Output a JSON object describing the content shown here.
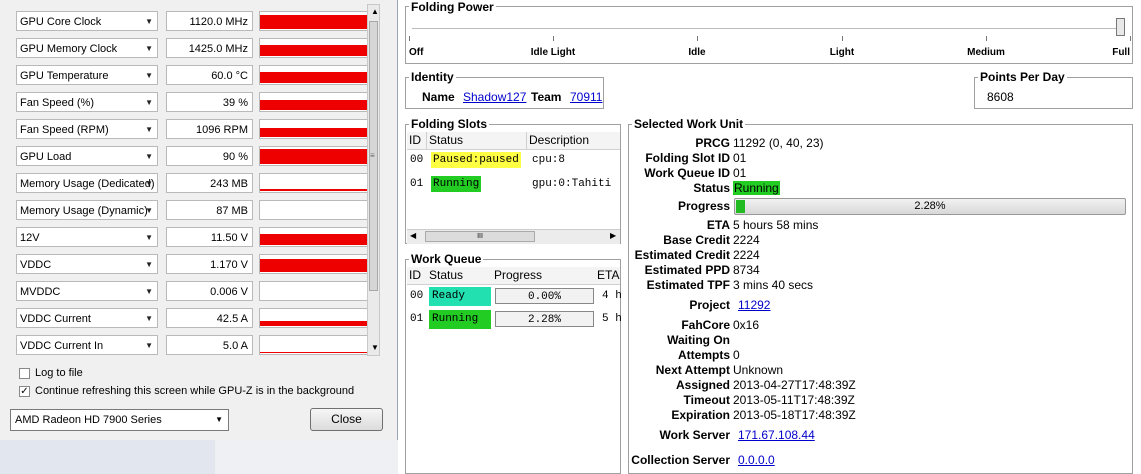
{
  "gpuz": {
    "sensors": [
      {
        "name": "GPU Core Clock",
        "value": "1120.0 MHz",
        "level": 0.78
      },
      {
        "name": "GPU Memory Clock",
        "value": "1425.0 MHz",
        "level": 0.62
      },
      {
        "name": "GPU Temperature",
        "value": "60.0 °C",
        "level": 0.6
      },
      {
        "name": "Fan Speed (%)",
        "value": "39 %",
        "level": 0.55
      },
      {
        "name": "Fan Speed (RPM)",
        "value": "1096 RPM",
        "level": 0.5
      },
      {
        "name": "GPU Load",
        "value": "90 %",
        "level": 0.85
      },
      {
        "name": "Memory Usage (Dedicated)",
        "value": "243 MB",
        "level": 0.1
      },
      {
        "name": "Memory Usage (Dynamic)",
        "value": "87 MB",
        "level": 0.0
      },
      {
        "name": "12V",
        "value": "11.50 V",
        "level": 0.6
      },
      {
        "name": "VDDC",
        "value": "1.170 V",
        "level": 0.7
      },
      {
        "name": "MVDDC",
        "value": "0.006 V",
        "level": 0.0
      },
      {
        "name": "VDDC Current",
        "value": "42.5 A",
        "level": 0.3
      },
      {
        "name": "VDDC Current In",
        "value": "5.0 A",
        "level": 0.05
      }
    ],
    "log_to_file": "Log to file",
    "continue_refresh": "Continue refreshing this screen while GPU-Z is in the background",
    "gpu_select": "AMD Radeon HD 7900 Series",
    "close_label": "Close",
    "colors": {
      "graph": "#ee0000"
    }
  },
  "fah": {
    "folding_power": {
      "title": "Folding Power",
      "ticks": [
        "Off",
        "Idle Light",
        "Idle",
        "Light",
        "Medium",
        "Full"
      ]
    },
    "identity": {
      "title": "Identity",
      "name_label": "Name",
      "name": "Shadow127",
      "team_label": "Team",
      "team": "70911"
    },
    "ppd": {
      "title": "Points Per Day",
      "value": "8608"
    },
    "slots": {
      "title": "Folding Slots",
      "headers": [
        "ID",
        "Status",
        "Description"
      ],
      "rows": [
        {
          "id": "00",
          "status": "Paused:paused",
          "desc": "cpu:8",
          "color": "#ffff44"
        },
        {
          "id": "01",
          "status": "Running",
          "desc": "gpu:0:Tahiti",
          "color": "#22cc22"
        }
      ],
      "scroll_thumb": "III"
    },
    "queue": {
      "title": "Work Queue",
      "headers": [
        "ID",
        "Status",
        "Progress",
        "ETA"
      ],
      "rows": [
        {
          "id": "00",
          "status": "Ready",
          "progress": "0.00%",
          "eta": "4 h",
          "color": "#22e0b0"
        },
        {
          "id": "01",
          "status": "Running",
          "progress": "2.28%",
          "eta": "5 h",
          "color": "#22cc22"
        }
      ]
    },
    "unit": {
      "title": "Selected Work Unit",
      "prcg_label": "PRCG",
      "prcg": "11292 (0, 40, 23)",
      "slot_label": "Folding Slot ID",
      "slot": "01",
      "queue_label": "Work Queue ID",
      "queue": "01",
      "status_label": "Status",
      "status": "Running",
      "progress_label": "Progress",
      "progress": "2.28%",
      "progress_fraction": 0.0228,
      "eta_label": "ETA",
      "eta": "5 hours 58 mins",
      "base_credit_label": "Base Credit",
      "base_credit": "2224",
      "est_credit_label": "Estimated Credit",
      "est_credit": "2224",
      "est_ppd_label": "Estimated PPD",
      "est_ppd": "8734",
      "est_tpf_label": "Estimated TPF",
      "est_tpf": "3 mins 40 secs",
      "project_label": "Project",
      "project": "11292",
      "fahcore_label": "FahCore",
      "fahcore": "0x16",
      "waiting_label": "Waiting On",
      "waiting": "",
      "attempts_label": "Attempts",
      "attempts": "0",
      "next_attempt_label": "Next Attempt",
      "next_attempt": "Unknown",
      "assigned_label": "Assigned",
      "assigned": "2013-04-27T17:48:39Z",
      "timeout_label": "Timeout",
      "timeout": "2013-05-11T17:48:39Z",
      "expiration_label": "Expiration",
      "expiration": "2013-05-18T17:48:39Z",
      "work_server_label": "Work Server",
      "work_server": "171.67.108.44",
      "collection_server_label": "Collection Server",
      "collection_server": "0.0.0.0"
    }
  }
}
